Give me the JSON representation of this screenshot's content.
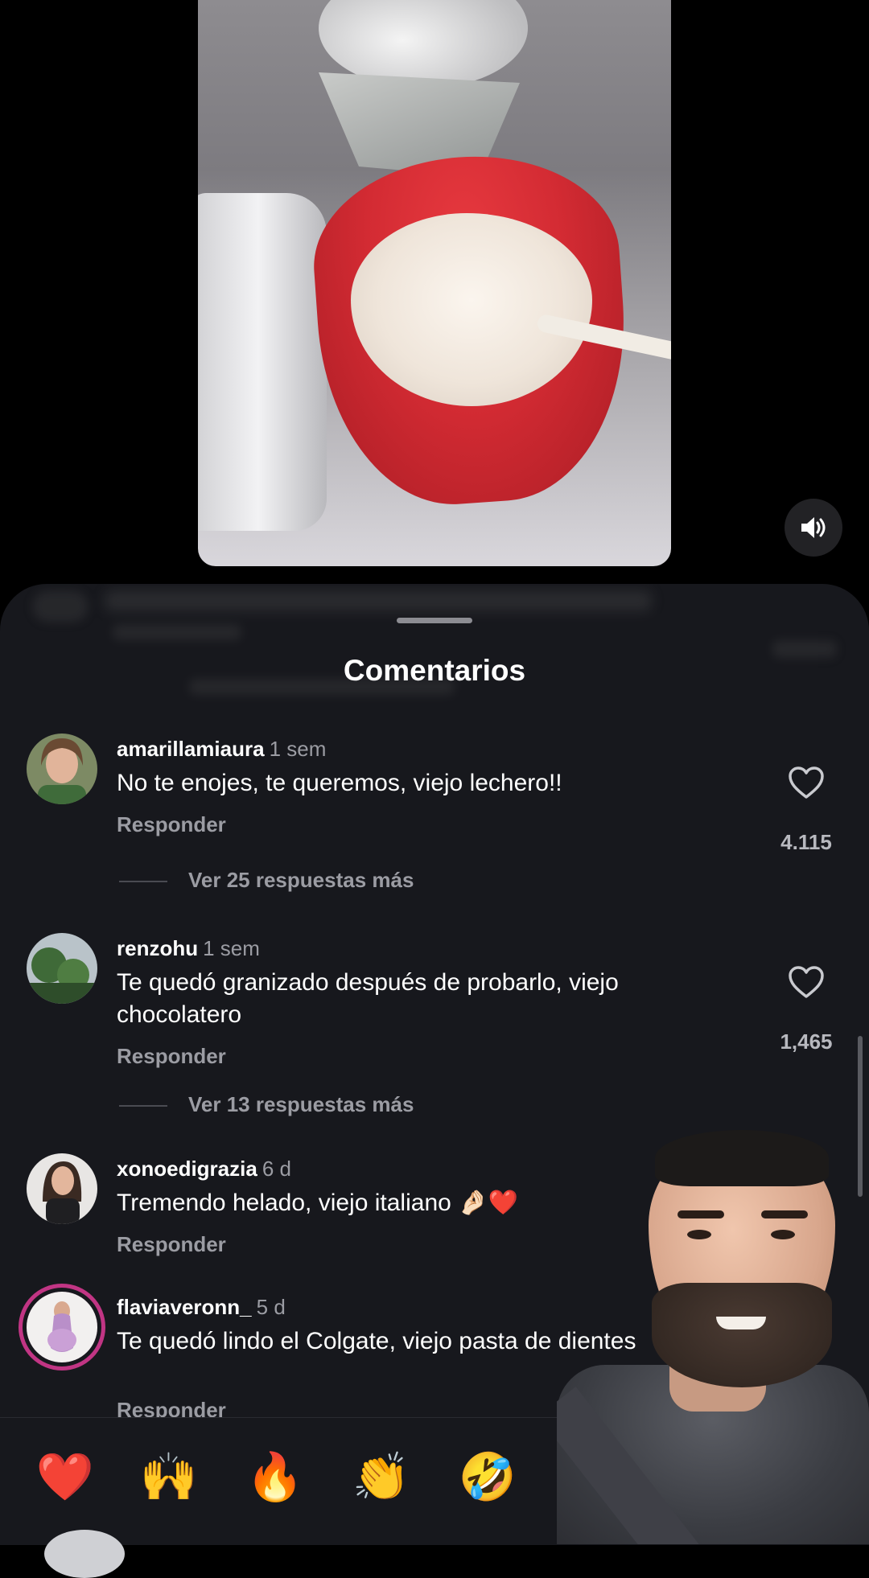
{
  "sheet": {
    "title": "Comentarios"
  },
  "comments": [
    {
      "username": "amarillamiaura",
      "time": "1 sem",
      "text": "No te enojes, te queremos, viejo lechero!!",
      "reply_label": "Responder",
      "likes": "4.115",
      "more_replies": "Ver 25 respuestas más"
    },
    {
      "username": "renzohu",
      "time": "1 sem",
      "text": "Te quedó granizado después de probarlo, viejo chocolatero",
      "reply_label": "Responder",
      "likes": "1,465",
      "more_replies": "Ver 13 respuestas más"
    },
    {
      "username": "xonoedigrazia",
      "time": "6 d",
      "text": "Tremendo helado, viejo italiano 🤌🏻❤️",
      "reply_label": "Responder"
    },
    {
      "username": "flaviaveronn_",
      "time": "5 d",
      "text": "Te quedó lindo el Colgate, viejo pasta de dientes",
      "reply_label": "Responder"
    }
  ],
  "emoji_bar": [
    "❤️",
    "🙌",
    "🔥",
    "👏",
    "🤣"
  ],
  "icons": {
    "volume": "volume-icon",
    "like": "heart-icon"
  }
}
